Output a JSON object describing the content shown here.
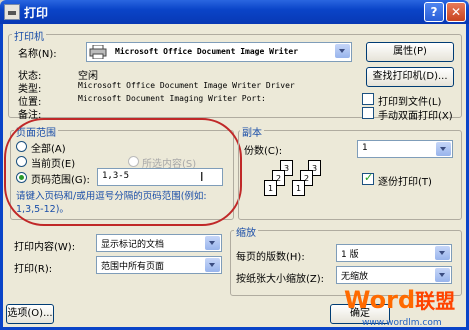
{
  "window": {
    "title": "打印",
    "help": "?",
    "close": "✕"
  },
  "printer": {
    "group_label": "打印机",
    "name_label": "名称(N):",
    "name_value": "Microsoft Office Document Image Writer",
    "properties": "属性(P)",
    "status_label": "状态:",
    "status_value": "空闲",
    "type_label": "类型:",
    "type_value": "Microsoft Office Document Image Writer Driver",
    "where_label": "位置:",
    "where_value": "Microsoft Document Imaging Writer Port:",
    "comment_label": "备注:",
    "find_printer": "查找打印机(D)...",
    "print_to_file": "打印到文件(L)",
    "manual_duplex": "手动双面打印(X)"
  },
  "page_range": {
    "group_label": "页面范围",
    "all": "全部(A)",
    "current": "当前页(E)",
    "selection": "所选内容(S)",
    "pages": "页码范围(G):",
    "pages_value": "1,3-5",
    "hint": "请键入页码和/或用逗号分隔的页码范围(例如: 1,3,5-12)。"
  },
  "copies": {
    "group_label": "副本",
    "count_label": "份数(C):",
    "count_value": "1",
    "collate": "逐份打印(T)",
    "pages_front": [
      "1",
      "2",
      "3"
    ],
    "pages_back": [
      "1",
      "2",
      "3"
    ]
  },
  "print_what": {
    "label": "打印内容(W):",
    "value": "显示标记的文档"
  },
  "print": {
    "label": "打印(R):",
    "value": "范围中所有页面"
  },
  "zoom": {
    "group_label": "缩放",
    "per_sheet_label": "每页的版数(H):",
    "per_sheet_value": "1 版",
    "scale_label": "按纸张大小缩放(Z):",
    "scale_value": "无缩放"
  },
  "footer": {
    "options": "选项(O)...",
    "ok": "确定"
  },
  "watermark": {
    "word": "Word",
    "cn": "联盟",
    "url": "www.wordlm.com"
  },
  "colors": {
    "title_blue": "#0a44c8",
    "annotation_red": "#c02828",
    "brand_orange": "#ff6a00"
  }
}
